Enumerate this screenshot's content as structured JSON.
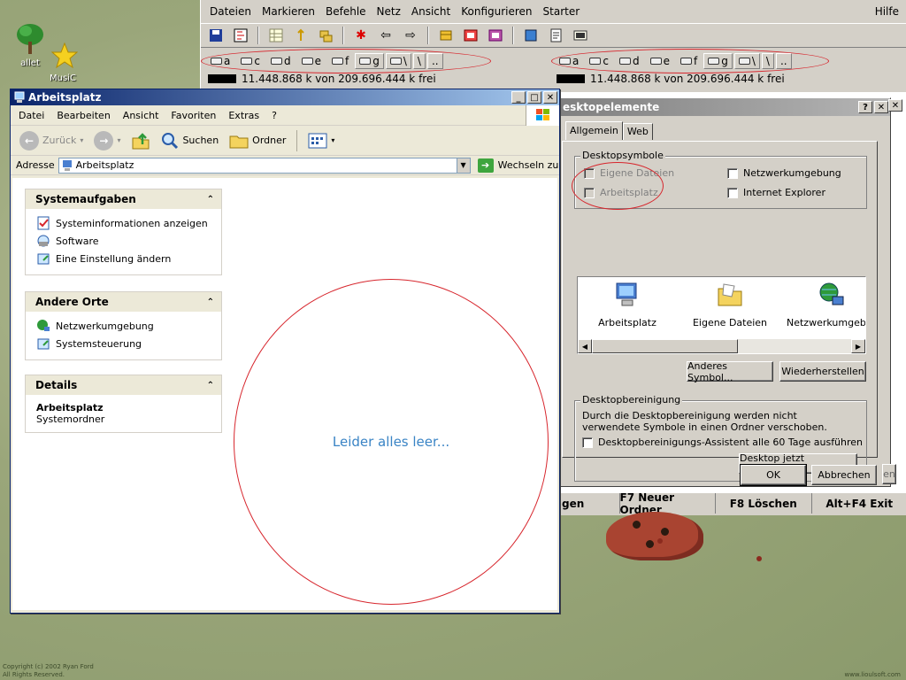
{
  "desktop": {
    "icons": [
      {
        "label": "allet"
      },
      {
        "label": "MusiC"
      }
    ],
    "copyright": [
      "Copyright (c) 2002 Ryan Ford",
      "All Rights Reserved."
    ],
    "website": "www.lioulsoft.com"
  },
  "totalcmd": {
    "menu": [
      "Dateien",
      "Markieren",
      "Befehle",
      "Netz",
      "Ansicht",
      "Konfigurieren",
      "Starter"
    ],
    "help": "Hilfe",
    "drives_left": [
      {
        "letter": "a"
      },
      {
        "letter": "c"
      },
      {
        "letter": "d"
      },
      {
        "letter": "e"
      },
      {
        "letter": "f"
      },
      {
        "letter": "g"
      },
      {
        "letter": "\\"
      },
      {
        "letter": "\\"
      },
      {
        "letter": ".."
      }
    ],
    "drives_right": [
      {
        "letter": "a"
      },
      {
        "letter": "c"
      },
      {
        "letter": "d"
      },
      {
        "letter": "e"
      },
      {
        "letter": "f"
      },
      {
        "letter": "g"
      },
      {
        "letter": "\\"
      },
      {
        "letter": "\\"
      },
      {
        "letter": ".."
      }
    ],
    "free_left": "11.448.868 k von 209.696.444 k frei",
    "free_right": "11.448.868 k von 209.696.444 k frei",
    "fkeys": [
      "gen",
      "F7 Neuer Ordner",
      "F8 Löschen",
      "Alt+F4 Exit"
    ]
  },
  "dialog": {
    "title": "esktopelemente",
    "tabs": [
      "Allgemein",
      "Web"
    ],
    "group_symbols": "Desktopsymbole",
    "checkboxes": {
      "eigene_dateien": "Eigene Dateien",
      "arbeitsplatz": "Arbeitsplatz",
      "netzwerkumgebung": "Netzwerkumgebung",
      "internet_explorer": "Internet Explorer"
    },
    "icon_items": [
      "Arbeitsplatz",
      "Eigene Dateien",
      "Netzwerkumgebun"
    ],
    "btn_other_symbol": "Anderes Symbol...",
    "btn_restore": "Wiederherstellen",
    "group_cleanup": "Desktopbereinigung",
    "cleanup_text": "Durch die Desktopbereinigung werden nicht verwendete Symbole in einen Ordner verschoben.",
    "cleanup_checkbox": "Desktopbereinigungs-Assistent alle 60 Tage ausführen",
    "btn_cleanup_now": "Desktop jetzt bereinigen",
    "btn_ok": "OK",
    "btn_cancel": "Abbrechen",
    "btn_edge": "en"
  },
  "explorer": {
    "title": "Arbeitsplatz",
    "menu": [
      "Datei",
      "Bearbeiten",
      "Ansicht",
      "Favoriten",
      "Extras",
      "?"
    ],
    "toolbar": {
      "back": "Zurück",
      "search": "Suchen",
      "folders": "Ordner"
    },
    "address_label": "Adresse",
    "address_value": "Arbeitsplatz",
    "go_label": "Wechseln zu",
    "panels": {
      "system_tasks": {
        "title": "Systemaufgaben",
        "items": [
          "Systeminformationen anzeigen",
          "Software",
          "Eine Einstellung ändern"
        ]
      },
      "other_places": {
        "title": "Andere Orte",
        "items": [
          "Netzwerkumgebung",
          "Systemsteuerung"
        ]
      },
      "details": {
        "title": "Details",
        "name": "Arbeitsplatz",
        "type": "Systemordner"
      }
    },
    "empty_message": "Leider alles leer..."
  },
  "colors": {
    "annotation_red": "#d7262d",
    "xp_title_blue": "#0a246a",
    "empty_text_blue": "#3a84c5"
  }
}
